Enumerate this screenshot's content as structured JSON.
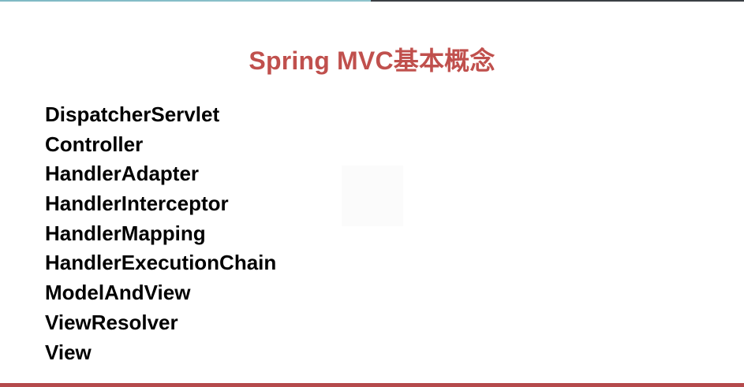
{
  "slide": {
    "title": "Spring MVC基本概念",
    "concepts": [
      "DispatcherServlet",
      "Controller",
      "HandlerAdapter",
      "HandlerInterceptor",
      "HandlerMapping",
      "HandlerExecutionChain",
      "ModelAndView",
      "ViewResolver",
      "View"
    ]
  },
  "colors": {
    "title": "#c0504d",
    "text": "#000000",
    "bottom_bar": "#b54a4c",
    "background": "#ffffff"
  }
}
